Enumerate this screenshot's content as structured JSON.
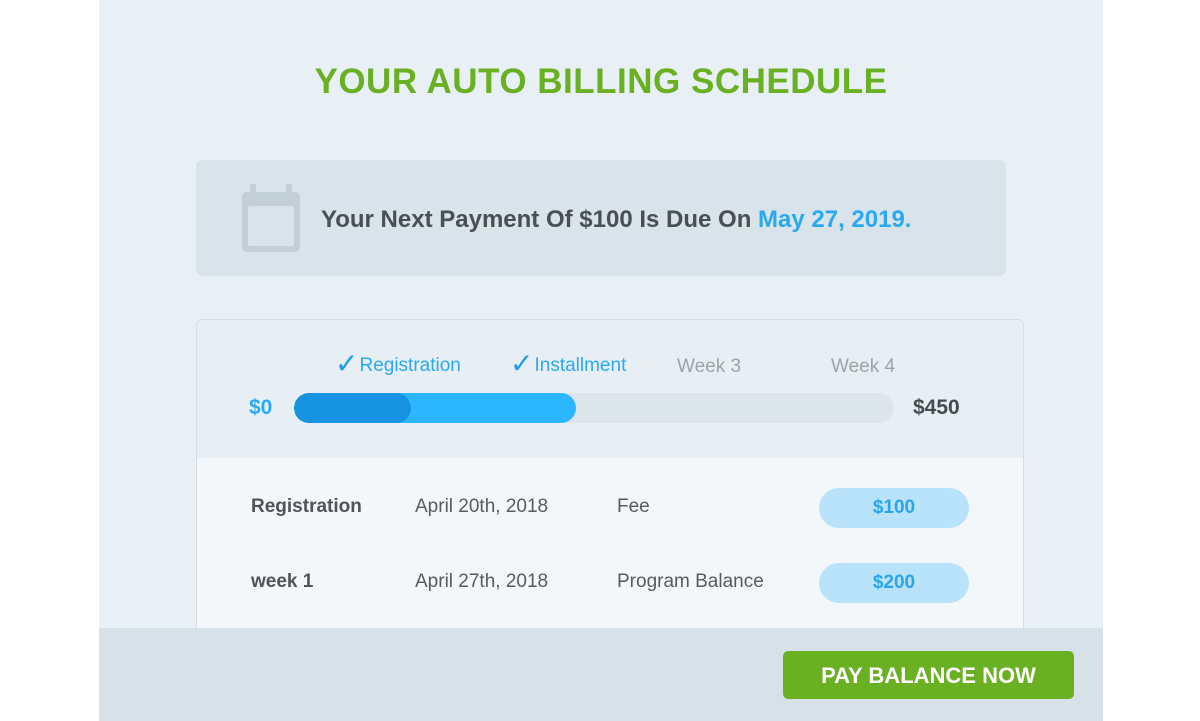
{
  "title": "YOUR AUTO BILLING SCHEDULE",
  "notice": {
    "text": "Your Next Payment Of $100 Is Due On",
    "date": "May 27, 2019.",
    "icon": "calendar-icon"
  },
  "progress": {
    "steps": [
      {
        "label": "Registration",
        "done": true
      },
      {
        "label": "Installment",
        "done": true
      },
      {
        "label": "Week 3",
        "done": false
      },
      {
        "label": "Week 4",
        "done": false
      }
    ],
    "start_label": "$0",
    "end_label": "$450",
    "paid_fraction": 0.47,
    "registration_fraction": 0.195
  },
  "payments": [
    {
      "name": "Registration",
      "date": "April 20th, 2018",
      "type": "Fee",
      "amount": "$100"
    },
    {
      "name": "week 1",
      "date": "April 27th, 2018",
      "type": "Program Balance",
      "amount": "$200"
    }
  ],
  "footer": {
    "button_label": "PAY BALANCE NOW"
  },
  "colors": {
    "brand_green": "#6ab023",
    "accent_blue": "#29aaf0",
    "progress_dark": "#1592e0",
    "progress_light": "#2cb6ff"
  }
}
